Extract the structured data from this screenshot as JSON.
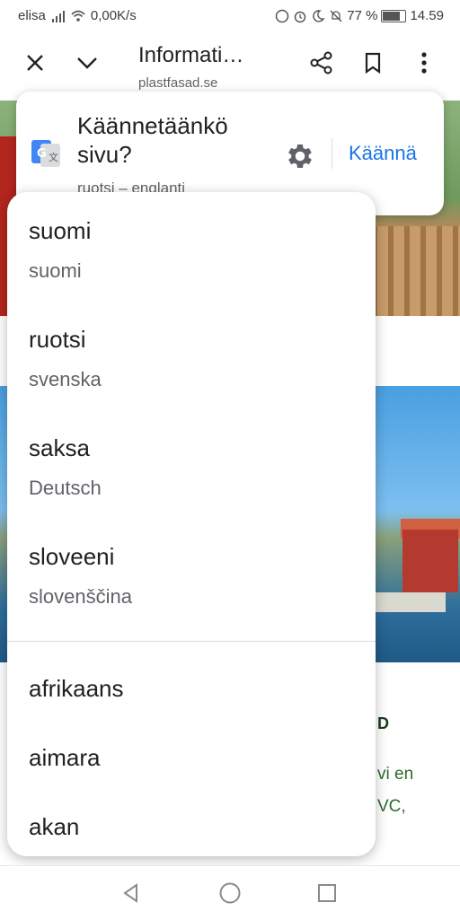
{
  "status_bar": {
    "carrier": "elisa",
    "net_speed": "0,00K/s",
    "battery": "77 %",
    "battery_level": 0.77,
    "time": "14.59"
  },
  "toolbar": {
    "title": "Informati…",
    "url": "plastfasad.se",
    "icons": [
      "close-icon",
      "chevron-down-icon",
      "share-icon",
      "bookmark-icon",
      "more-vert-icon"
    ]
  },
  "page_text": {
    "heading_fragment": "D",
    "line1": "vi en",
    "line2": "VC,"
  },
  "translate_card": {
    "title": "Käännetäänkö sivu?",
    "languages": "ruotsi – englanti",
    "translate_button": "Käännä"
  },
  "menu": {
    "recent": [
      {
        "name": "suomi",
        "native": "suomi"
      },
      {
        "name": "ruotsi",
        "native": "svenska"
      },
      {
        "name": "saksa",
        "native": "Deutsch"
      },
      {
        "name": "sloveeni",
        "native": "slovenščina"
      }
    ],
    "all": [
      {
        "name": "afrikaans"
      },
      {
        "name": "aimara"
      },
      {
        "name": "akan"
      }
    ]
  },
  "colors": {
    "accent": "#1a73e8",
    "page_green_text": "#2c6b2b"
  },
  "nav_bar": {
    "icons": [
      "back-triangle-icon",
      "home-circle-icon",
      "recents-square-icon"
    ]
  }
}
